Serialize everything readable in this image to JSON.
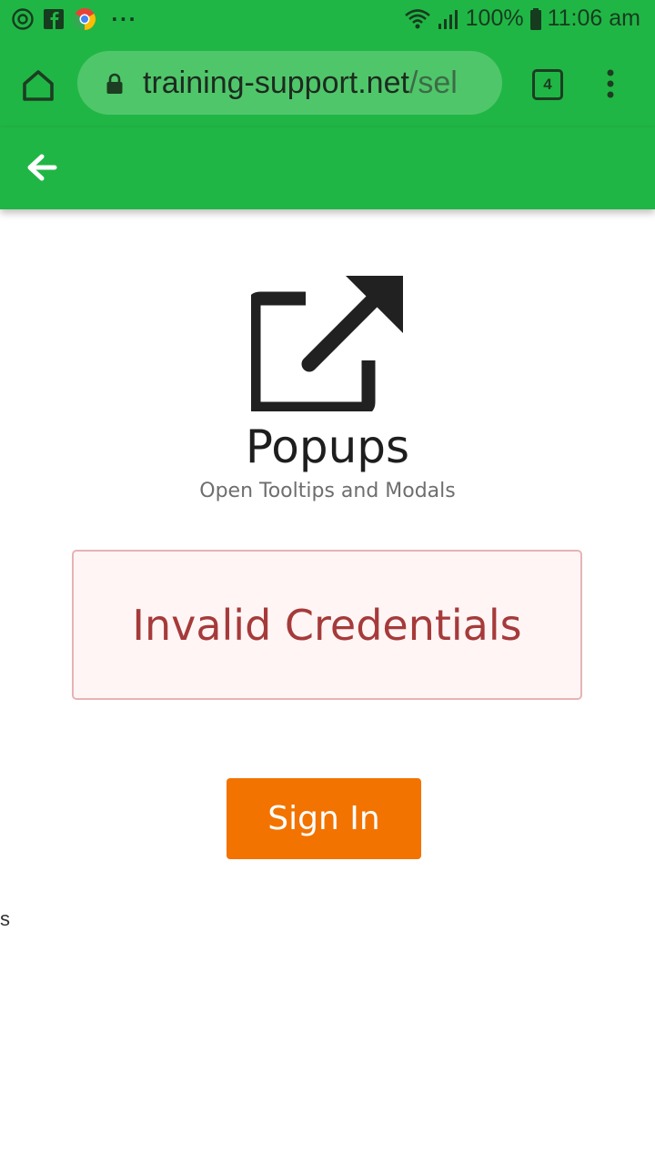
{
  "status_bar": {
    "battery": "100%",
    "time": "11:06 am",
    "notification_icons": [
      "screen-record-icon",
      "facebook-icon",
      "chrome-icon"
    ],
    "overflow": "···"
  },
  "browser": {
    "url_domain": "training-support.net",
    "url_path": "/sel",
    "tab_count": "4"
  },
  "app_bar": {
    "back_icon": "arrow-left-icon"
  },
  "page": {
    "hero_icon": "external-link-icon",
    "title": "Popups",
    "subtitle": "Open Tooltips and Modals",
    "alert_message": "Invalid Credentials",
    "sign_in_label": "Sign In",
    "stray_text": "s"
  },
  "colors": {
    "brand_green": "#20b645",
    "url_box": "#50c66a",
    "button_orange": "#f27300",
    "alert_text": "#a63a3a",
    "alert_bg": "#fff5f5",
    "alert_border": "#e6b3b6"
  }
}
